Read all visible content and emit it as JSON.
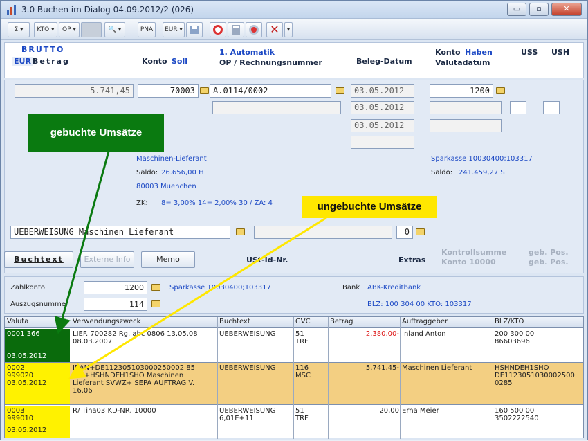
{
  "window": {
    "title": "3.0  Buchen im Dialog 04.09.2012/2 (026)",
    "minimize": "▭",
    "maximize": "▫",
    "close": "✕"
  },
  "toolbar": {
    "sum": "Σ ▾",
    "kto": "KTO ▾",
    "op": "OP ▾",
    "preview": "🔍 ▾",
    "pna": "PNA",
    "eur": "EUR ▾",
    "cancel": "✕"
  },
  "header": {
    "brutto": "BRUTTO",
    "eur": "EUR",
    "betrag": "Betrag",
    "konto": "Konto",
    "soll": "Soll",
    "automatik": "1. Automatik",
    "op_nr": "OP / Rechnungsnummer",
    "beleg_datum": "Beleg-Datum",
    "konto2": "Konto",
    "haben": "Haben",
    "valutadatum": "Valutadatum",
    "uss": "USS",
    "ush": "USH"
  },
  "form": {
    "betrag": "5.741,45",
    "konto_soll": "70003",
    "op_nummer": "A.0114/0002",
    "beleg_datum_1": "03.05.2012",
    "beleg_datum_2": "03.05.2012",
    "beleg_datum_3": "03.05.2012",
    "konto_haben": "1200",
    "soll_name": "Maschinen-Lieferant",
    "soll_saldo_label": "Saldo:",
    "soll_saldo": "26.656,00 H",
    "soll_city": "80003 Muenchen",
    "zk_label": "ZK:",
    "zk_value": "8= 3,00%  14= 2,00%  30 / ZA: 4",
    "haben_name": "Sparkasse 10030400;103317",
    "haben_saldo_label": "Saldo:",
    "haben_saldo": "241.459,27 S",
    "buchtext_field": "UEBERWEISUNG Maschinen Lieferant",
    "zero_field": "0"
  },
  "overlays": {
    "gebuchte": "gebuchte Umsätze",
    "ungebuchte": "ungebuchte Umsätze",
    "gebuchte_color": "#0a7a10",
    "ungebuchte_color": "#ffe700"
  },
  "buttons": {
    "buchtext": "Buchtext",
    "externe_info": "Externe Info",
    "memo": "Memo",
    "ust_id": "USt-Id-Nr.",
    "extras": "Extras",
    "kontrollsumme": "Kontrollsumme",
    "konto_10000": "Konto 10000",
    "geb_pos_1": "geb. Pos.",
    "geb_pos_2": "geb. Pos."
  },
  "bank": {
    "zahlkonto_label": "Zahlkonto",
    "zahlkonto": "1200",
    "zahlkonto_name": "Sparkasse 10030400;103317",
    "auszug_label": "Auszugsnummer",
    "auszug": "114",
    "bank_label": "Bank",
    "bank_name": "ABK-Kreditbank",
    "blz": "BLZ: 100 304 00   KTO: 103317"
  },
  "grid": {
    "columns": [
      "Valuta",
      "Verwendungszweck",
      "Buchtext",
      "GVC",
      "Betrag",
      "Auftraggeber",
      "BLZ/KTO"
    ],
    "rows": [
      {
        "valuta_1": "0001  366",
        "valuta_2": "03.05.2012",
        "zweck_1": "LIEF. 700282 Rg. abc 0806         13.05.08",
        "zweck_2": "08.03.2007",
        "buchtext": "UEBERWEISUNG",
        "gvc_1": "51",
        "gvc_2": "TRF",
        "betrag": "2.380,00-",
        "auftraggeber": "Inland Anton",
        "blz_1": "200 300 00",
        "blz_2": "86603696"
      },
      {
        "valuta_1": "0002",
        "valuta_2": "999020",
        "valuta_3": "03.05.2012",
        "zweck_1": "IBAN+DE112305103000250002 85",
        "zweck_2": "BIC+HSHNDEH1SHO Maschinen",
        "zweck_3": "Lieferant SVWZ+ SEPA AUFTRAG V.",
        "zweck_4": "16.06",
        "buchtext": "UEBERWEISUNG",
        "gvc_1": "116",
        "gvc_2": "MSC",
        "betrag": "5.741,45-",
        "auftraggeber": "Maschinen Lieferant",
        "blz_1": "HSHNDEH1SHO",
        "blz_2": "DE1123051030002500",
        "blz_3": "0285"
      },
      {
        "valuta_1": "0003",
        "valuta_2": "999010",
        "valuta_3": "03.05.2012",
        "zweck_1": "R/ Tina03 KD-NR. 10000",
        "buchtext_1": "UEBERWEISUNG",
        "buchtext_2": "6,01E+11",
        "gvc_1": "51",
        "gvc_2": "TRF",
        "betrag": "20,00",
        "auftraggeber": "Erna Meier",
        "blz_1": "160 500 00",
        "blz_2": "3502222540"
      }
    ]
  }
}
